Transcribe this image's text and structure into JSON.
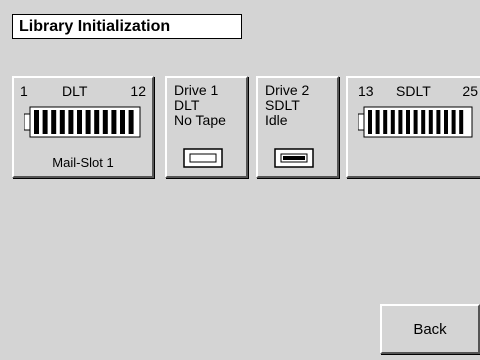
{
  "title": "Library Initialization",
  "magazine_left": {
    "start": "1",
    "type": "DLT",
    "end": "12",
    "footer": "Mail-Slot 1",
    "icon": "tape-magazine-icon"
  },
  "drive1": {
    "line1": "Drive 1",
    "line2": "DLT",
    "line3": "No Tape",
    "icon": "empty-drive-icon"
  },
  "drive2": {
    "line1": "Drive 2",
    "line2": "SDLT",
    "line3": "Idle",
    "icon": "loaded-drive-icon"
  },
  "magazine_right": {
    "start": "13",
    "type": "SDLT",
    "end": "25",
    "icon": "tape-magazine-icon"
  },
  "back_label": "Back",
  "colors": {
    "background": "#d4d4d4",
    "title_background": "#ffffff"
  }
}
